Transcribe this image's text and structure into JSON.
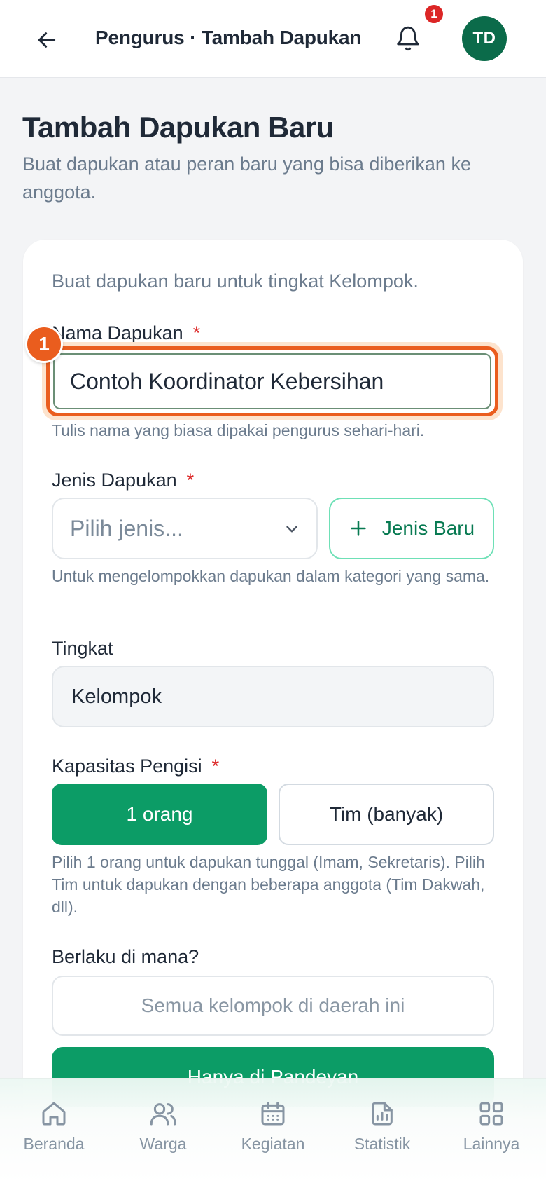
{
  "header": {
    "title": "Pengurus · Tambah Dapukan",
    "notification_count": "1",
    "avatar_initials": "TD"
  },
  "page": {
    "title": "Tambah Dapukan Baru",
    "subtitle": "Buat dapukan atau peran baru yang bisa diberikan ke anggota."
  },
  "form": {
    "intro": "Buat dapukan baru untuk tingkat Kelompok.",
    "step_badge": "1",
    "nama": {
      "label": "Nama Dapukan",
      "required_mark": "*",
      "value": "Contoh Koordinator Kebersihan",
      "hint": "Tulis nama yang biasa dipakai pengurus sehari-hari."
    },
    "jenis": {
      "label": "Jenis Dapukan",
      "required_mark": "*",
      "placeholder": "Pilih jenis...",
      "new_button_label": "Jenis Baru",
      "hint": "Untuk mengelompokkan dapukan dalam kategori yang sama."
    },
    "tingkat": {
      "label": "Tingkat",
      "value": "Kelompok"
    },
    "kapasitas": {
      "label": "Kapasitas Pengisi",
      "required_mark": "*",
      "options": [
        "1 orang",
        "Tim (banyak)"
      ],
      "selected": "1 orang",
      "hint": "Pilih 1 orang untuk dapukan tunggal (Imam, Sekretaris). Pilih Tim untuk dapukan dengan beberapa anggota (Tim Dakwah, dll)."
    },
    "berlaku": {
      "label": "Berlaku di mana?",
      "options": [
        "Semua kelompok di daerah ini",
        "Hanya di Pandeyan"
      ],
      "selected": "Hanya di Pandeyan"
    }
  },
  "bottom_nav": {
    "items": [
      {
        "label": "Beranda",
        "icon": "home-icon"
      },
      {
        "label": "Warga",
        "icon": "users-icon"
      },
      {
        "label": "Kegiatan",
        "icon": "calendar-icon"
      },
      {
        "label": "Statistik",
        "icon": "chart-icon"
      },
      {
        "label": "Lainnya",
        "icon": "grid-icon"
      }
    ]
  },
  "colors": {
    "brand_green": "#0c9c66",
    "avatar_green": "#0b6b4a",
    "focus_orange": "#ea5d1e",
    "required_red": "#dc2626"
  }
}
